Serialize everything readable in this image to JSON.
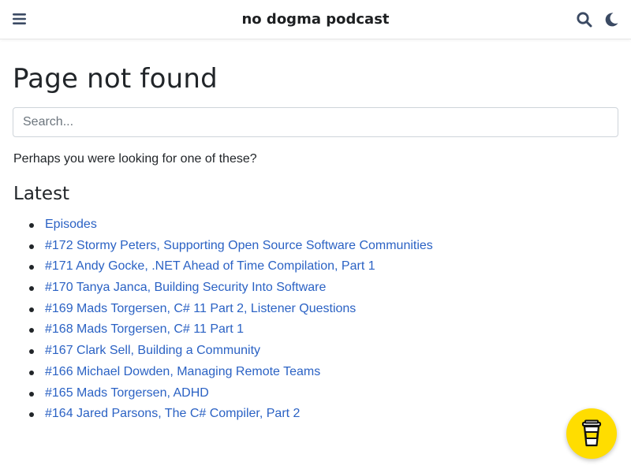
{
  "navbar": {
    "title": "no dogma podcast",
    "menu_icon": "hamburger-menu-icon",
    "search_icon": "search-icon",
    "theme_icon": "moon-icon"
  },
  "main": {
    "title": "Page not found",
    "search_placeholder": "Search...",
    "suggestion_text": "Perhaps you were looking for one of these?",
    "latest_heading": "Latest",
    "latest_items": [
      "Episodes",
      "#172 Stormy Peters, Supporting Open Source Software Communities",
      "#171 Andy Gocke, .NET Ahead of Time Compilation, Part 1",
      "#170 Tanya Janca, Building Security Into Software",
      "#169 Mads Torgersen, C# 11 Part 2, Listener Questions",
      "#168 Mads Torgersen, C# 11 Part 1",
      "#167 Clark Sell, Building a Community",
      "#166 Michael Dowden, Managing Remote Teams",
      "#165 Mads Torgersen, ADHD",
      "#164 Jared Parsons, The C# Compiler, Part 2"
    ]
  },
  "floating": {
    "coffee_icon": "coffee-cup-icon"
  },
  "colors": {
    "link": "#2b62c4",
    "icon": "#3b4a63",
    "coffee_button": "#ffdd00"
  }
}
